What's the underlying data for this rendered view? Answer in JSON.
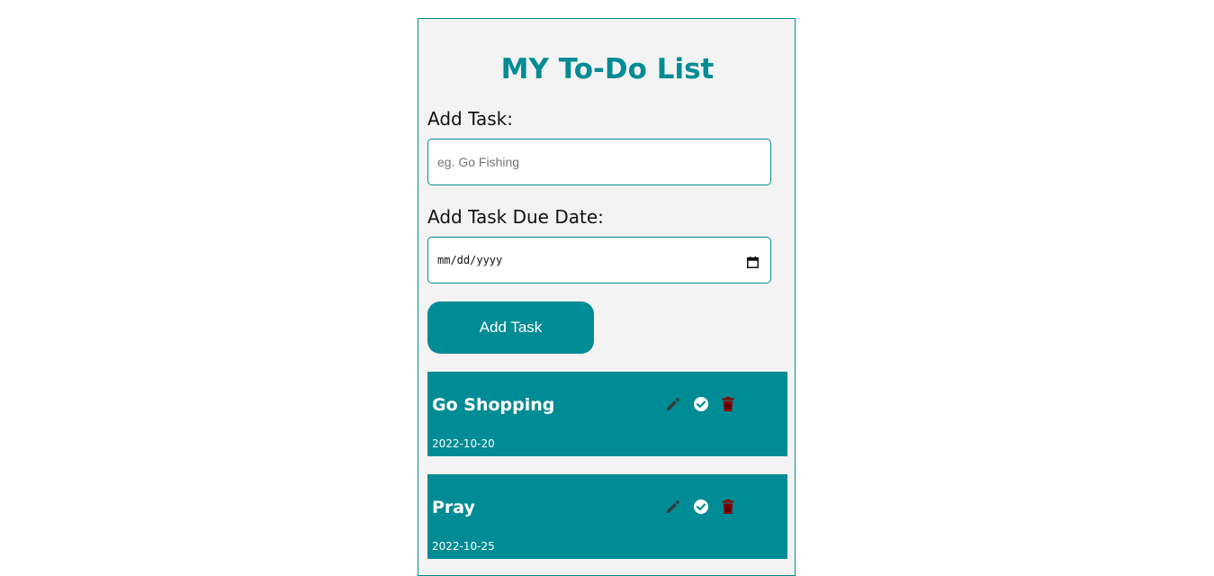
{
  "app": {
    "title": "MY To-Do List"
  },
  "form": {
    "task_label": "Add Task:",
    "task_placeholder": "eg. Go Fishing",
    "task_value": "",
    "date_label": "Add Task Due Date:",
    "date_placeholder": "mm/dd/yyyy",
    "add_button_label": "Add Task"
  },
  "tasks": [
    {
      "name": "Go Shopping",
      "due": "2022-10-20"
    },
    {
      "name": "Pray",
      "due": "2022-10-25"
    }
  ],
  "colors": {
    "accent": "#008c95",
    "panel_bg": "#f3f3f3",
    "edit_icon": "#3a3a3a",
    "done_icon": "#ffffff",
    "delete_icon": "#8b0000"
  },
  "icons": {
    "edit": "pencil-icon",
    "done": "check-circle-icon",
    "delete": "trash-icon",
    "date_picker": "calendar-icon"
  }
}
